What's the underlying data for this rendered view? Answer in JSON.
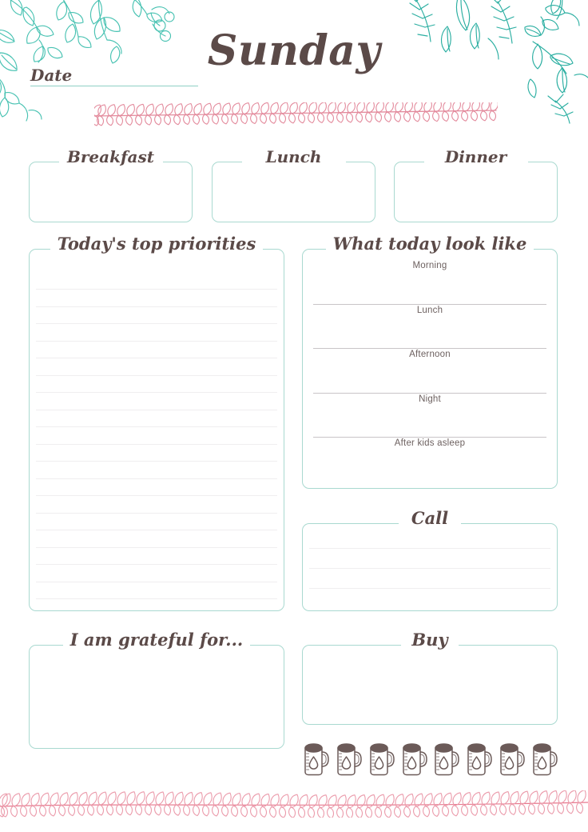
{
  "page": {
    "title": "Sunday",
    "date_label": "Date",
    "date_value": "",
    "accent_teal": "#a9d9d0",
    "accent_pink": "#e8a0ae",
    "ink": "#5b4a48",
    "rule_color": "#c9c5c7"
  },
  "decor": {
    "top_left": "botanical-leaves-illustration",
    "top_right": "botanical-leaves-illustration",
    "divider_top": "laurel-divider",
    "divider_bottom": "laurel-divider"
  },
  "meals": [
    {
      "label": "Breakfast",
      "value": ""
    },
    {
      "label": "Lunch",
      "value": ""
    },
    {
      "label": "Dinner",
      "value": ""
    }
  ],
  "priorities": {
    "label": "Today's top priorities",
    "value": "",
    "line_count": 19
  },
  "schedule": {
    "label": "What today look like",
    "slots": [
      {
        "label": "Morning",
        "value": ""
      },
      {
        "label": "Lunch",
        "value": ""
      },
      {
        "label": "Afternoon",
        "value": ""
      },
      {
        "label": "Night",
        "value": ""
      },
      {
        "label": "After kids asleep",
        "value": ""
      }
    ]
  },
  "call": {
    "label": "Call",
    "value": "",
    "line_count": 3
  },
  "grateful": {
    "label": "I am grateful for...",
    "value": ""
  },
  "buy": {
    "label": "Buy",
    "value": ""
  },
  "water": {
    "icon": "mug-water-drop-icon",
    "count": 8,
    "checked": 0
  }
}
